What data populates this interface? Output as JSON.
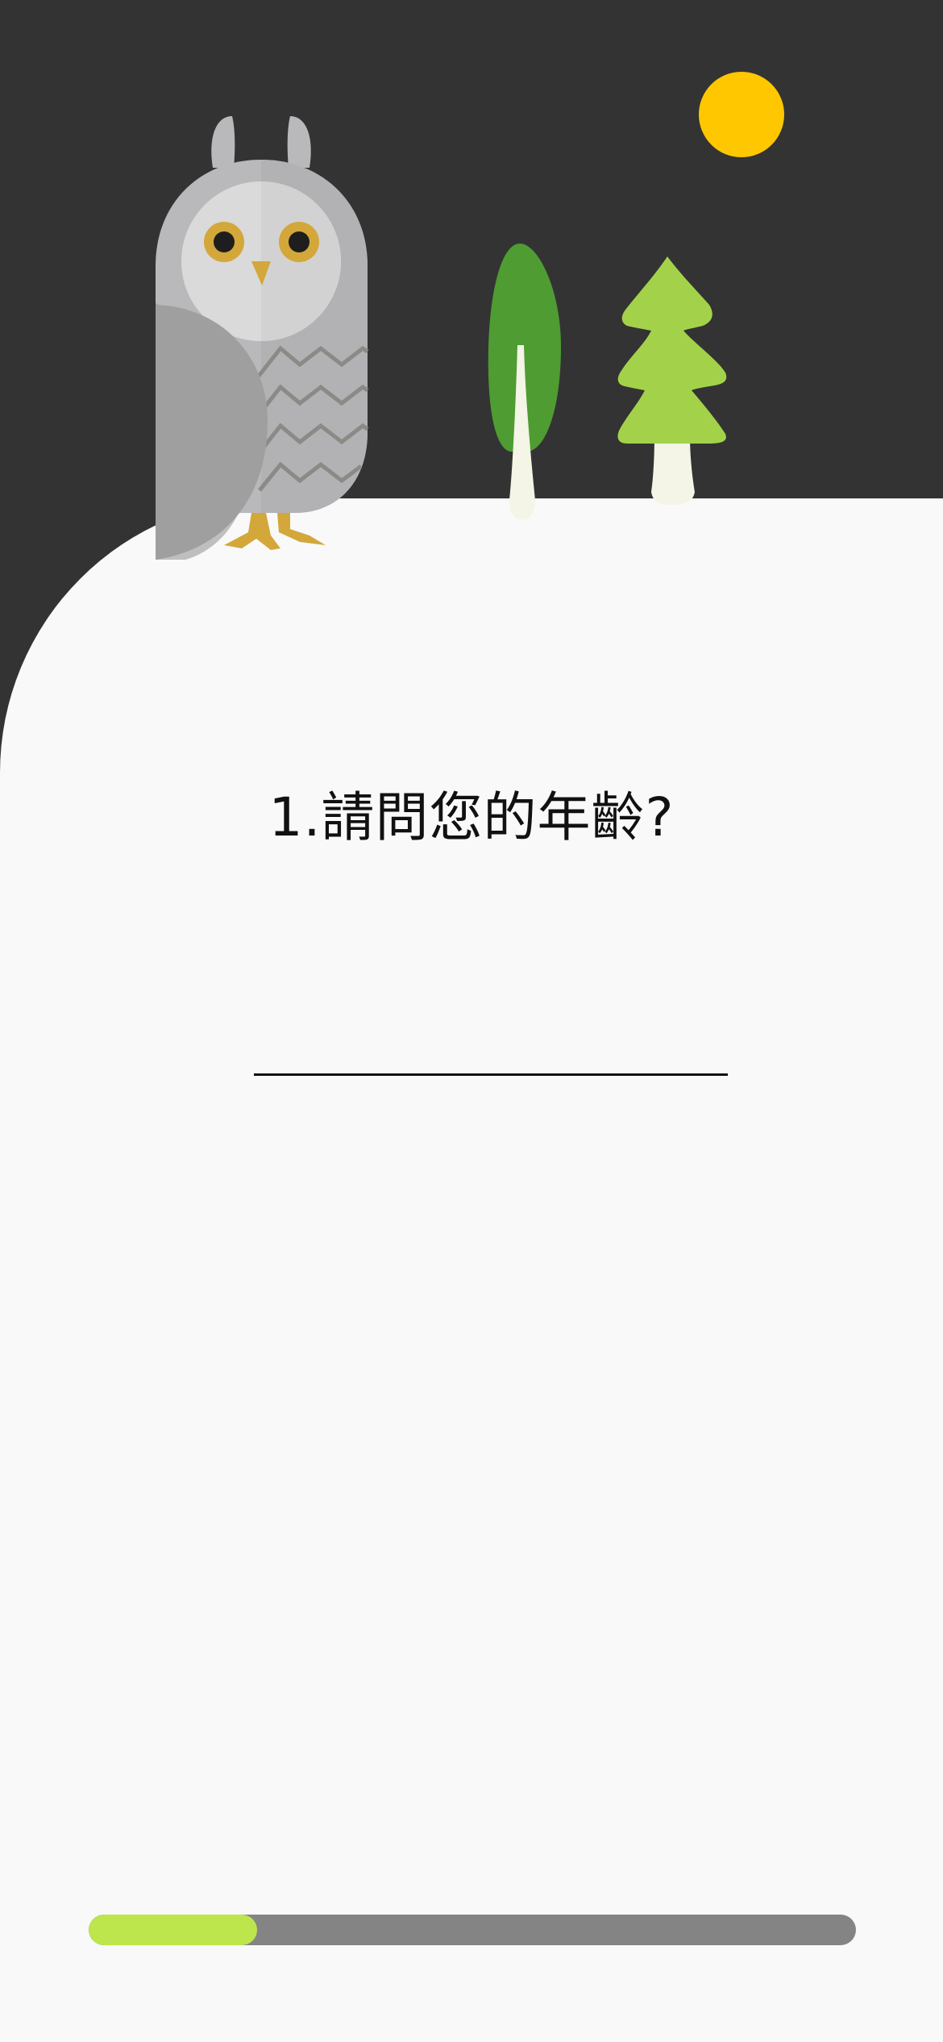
{
  "question": {
    "text": "1.請問您的年齡?"
  },
  "answer": {
    "value": "",
    "placeholder": ""
  },
  "progress": {
    "fraction": 0.22
  },
  "illustration": {
    "elements": [
      "owl",
      "round-tree",
      "pine-tree",
      "moon"
    ]
  },
  "colors": {
    "night_sky": "#333333",
    "page_background": "#f9f9f9",
    "moon": "#ffc700",
    "owl_body": "#b9b9bb",
    "owl_wing": "#9f9f9f",
    "owl_eye": "#d3a73a",
    "round_tree": "#4e9c32",
    "pine_tree": "#a3d24a",
    "trunk": "#f4f5e6",
    "progress_fill": "#bde54c",
    "progress_track": "#848484"
  }
}
